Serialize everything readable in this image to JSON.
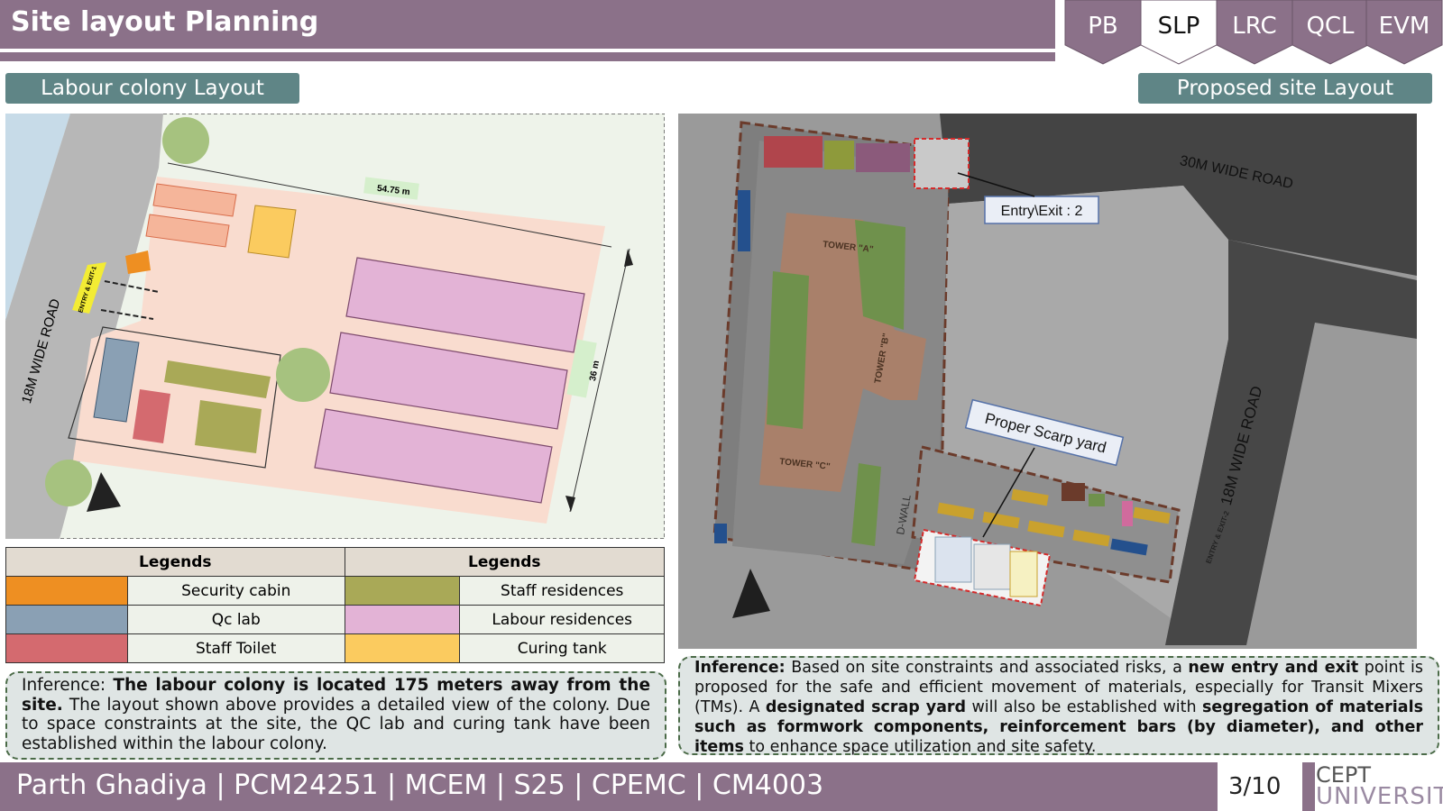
{
  "header": {
    "title": "Site layout Planning"
  },
  "tabs": [
    {
      "label": "PB",
      "active": false
    },
    {
      "label": "SLP",
      "active": true
    },
    {
      "label": "LRC",
      "active": false
    },
    {
      "label": "QCL",
      "active": false
    },
    {
      "label": "EVM",
      "active": false
    }
  ],
  "left": {
    "section_label": "Labour colony Layout",
    "map": {
      "road_label": "18M WIDE ROAD",
      "entry_label": "ENTRY & EXIT-1",
      "dim_length": "54.75 m",
      "dim_width": "36 m"
    },
    "legend": {
      "header_left": "Legends",
      "header_right": "Legends",
      "items": [
        {
          "label": "Security cabin",
          "color": "#ee8f22"
        },
        {
          "label": "Staff residences",
          "color": "#a9a957"
        },
        {
          "label": "Qc lab",
          "color": "#8aa0b4"
        },
        {
          "label": "Labour residences",
          "color": "#e3b3d6"
        },
        {
          "label": "Staff Toilet",
          "color": "#d46a6f"
        },
        {
          "label": "Curing tank",
          "color": "#fbcb5f"
        }
      ]
    },
    "inference": {
      "prefix": "Inference: ",
      "bold": "The labour colony is located 175 meters away from the site.",
      "rest": " The layout shown above provides a detailed view of the colony. Due to space constraints at the site, the QC lab and curing tank have been established within the labour colony."
    }
  },
  "right": {
    "section_label": "Proposed site Layout",
    "map": {
      "road_top": "30M WIDE ROAD",
      "road_right": "18M WIDE ROAD",
      "entry_exit_2_callout": "Entry\\Exit : 2",
      "scrap_yard_callout": "Proper Scarp yard",
      "tower_a": "TOWER \"A\"",
      "tower_b": "TOWER \"B\"",
      "tower_c": "TOWER \"C\"",
      "dwall": "D-WALL",
      "entry_exit_2_label": "ENTRY & EXIT-2"
    },
    "inference": {
      "label": "Inference:",
      "t1": " Based on site constraints and associated risks, a ",
      "b1": "new entry and exit",
      "t2": " point is proposed for the safe and efficient movement of materials, especially for Transit Mixers (TMs). A ",
      "b2": "designated scrap yard",
      "t3": " will also be established with ",
      "b3": "segregation of materials such as formwork components, reinforcement bars (by diameter), and other items",
      "t4": " to enhance space utilization and site safety."
    }
  },
  "footer": {
    "text": "Parth Ghadiya | PCM24251 | MCEM | S25 | CPEMC | CM4003",
    "page": "3/10"
  },
  "logo": {
    "line1": "CEPT",
    "line2": "UNIVERSITY"
  },
  "colors": {
    "accent": "#8b7189",
    "label_teal": "#5f8586",
    "inference_bg": "#dfe5e4"
  }
}
